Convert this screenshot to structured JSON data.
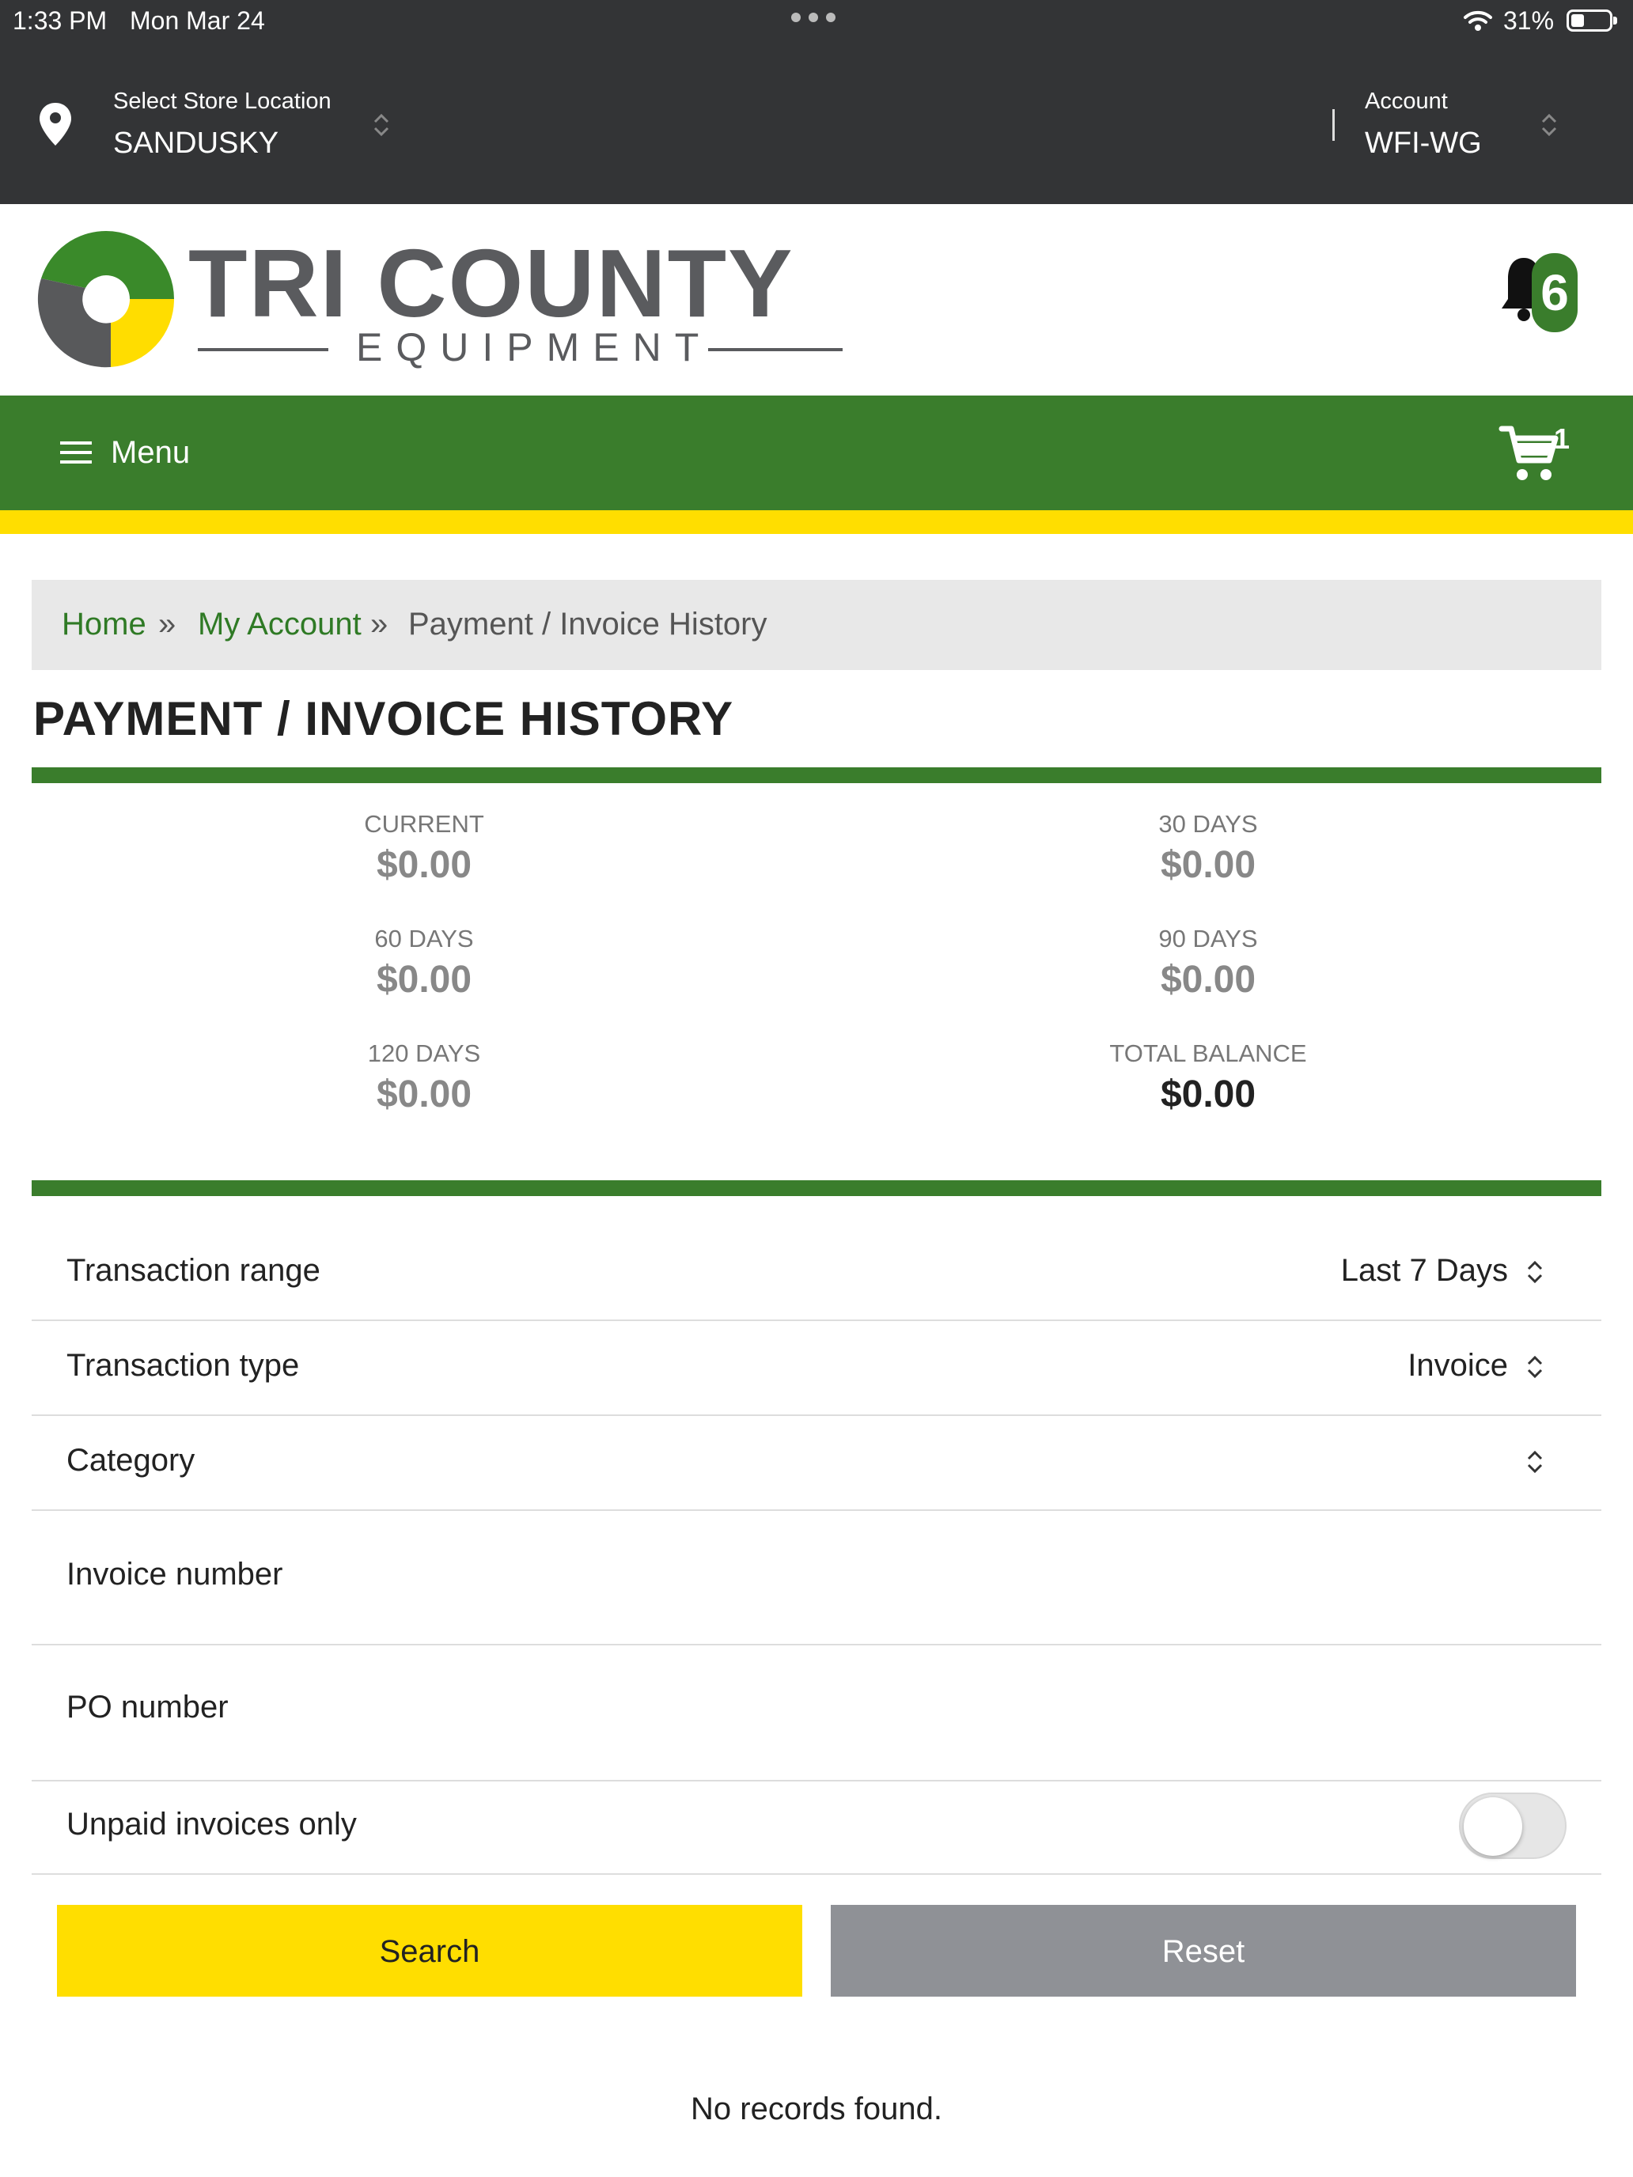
{
  "status_bar": {
    "time": "1:33 PM",
    "date": "Mon Mar 24",
    "battery": "31%"
  },
  "header": {
    "store_label": "Select Store Location",
    "store_value": "SANDUSKY",
    "account_label": "Account",
    "account_value": "WFI-WG"
  },
  "logo": {
    "title": "TRI COUNTY",
    "subtitle": "EQUIPMENT"
  },
  "notifications": {
    "count": "6"
  },
  "nav": {
    "menu_label": "Menu",
    "cart_count": "1"
  },
  "breadcrumb": {
    "home": "Home",
    "sep": "»",
    "account": "My Account",
    "current": "Payment / Invoice History"
  },
  "page": {
    "title": "PAYMENT / INVOICE HISTORY"
  },
  "aging": [
    {
      "label": "CURRENT",
      "value": "$0.00"
    },
    {
      "label": "30 DAYS",
      "value": "$0.00"
    },
    {
      "label": "60 DAYS",
      "value": "$0.00"
    },
    {
      "label": "90 DAYS",
      "value": "$0.00"
    },
    {
      "label": "120 DAYS",
      "value": "$0.00"
    },
    {
      "label": "TOTAL BALANCE",
      "value": "$0.00"
    }
  ],
  "filters": {
    "range_label": "Transaction range",
    "range_value": "Last 7 Days",
    "type_label": "Transaction type",
    "type_value": "Invoice",
    "category_label": "Category",
    "category_value": "",
    "invoice_label": "Invoice number",
    "po_label": "PO number",
    "unpaid_label": "Unpaid invoices only",
    "unpaid_on": false
  },
  "buttons": {
    "search": "Search",
    "reset": "Reset"
  },
  "results": {
    "empty": "No records found."
  },
  "colors": {
    "brand_green": "#3a7d2c",
    "brand_yellow": "#ffde00",
    "dark_bar": "#333436",
    "reset_gray": "#8f9196"
  }
}
